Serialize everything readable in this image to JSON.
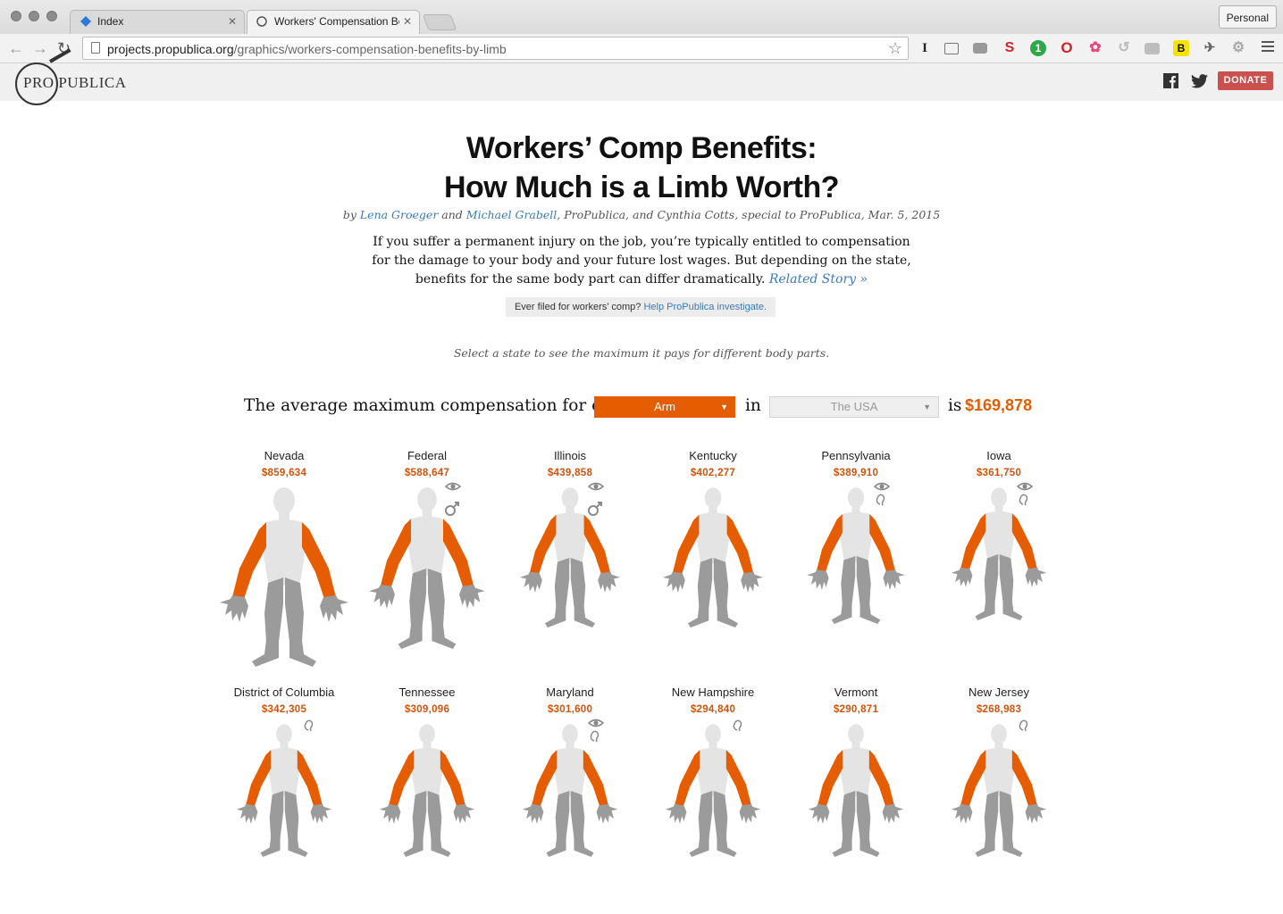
{
  "browser": {
    "tabs": [
      {
        "label": "Index",
        "active": false
      },
      {
        "label": "Workers' Compensation Be",
        "active": true
      }
    ],
    "profile": "Personal",
    "url_host": "projects.propublica.org",
    "url_path": "/graphics/workers-compensation-benefits-by-limb"
  },
  "site": {
    "logo_text": "PRO PUBLICA",
    "donate_label": "DONATE"
  },
  "article": {
    "title_line1": "Workers’ Comp Benefits:",
    "title_line2": "How Much is a Limb Worth?",
    "byline_by": "by",
    "author1": "Lena Groeger",
    "byline_and": "and",
    "author2": "Michael Grabell",
    "byline_rest": ", ProPublica, and Cynthia Cotts, special to ProPublica, Mar. 5, 2015",
    "intro_text": "If you suffer a permanent injury on the job, you’re typically entitled to compensation for the damage to your body and your future lost wages. But depending on the state, benefits for the same body part can differ dramatically.",
    "related_link": "Related Story »",
    "cta_text": "Ever filed for workers’ comp?",
    "cta_link": "Help ProPublica investigate.",
    "hint": "Select a state to see the maximum it pays for different body parts."
  },
  "selector": {
    "lead": "The average maximum compensation for one",
    "body_part": "Arm",
    "in_word": "in",
    "state": "The USA",
    "is_word": "is",
    "amount": "$169,878"
  },
  "colors": {
    "accent": "#e65c00",
    "body_gray": "#9b9b9b",
    "body_light": "#e4e4e4"
  },
  "states": [
    {
      "name": "Nevada",
      "amount": "$859,634",
      "scale": 1.0,
      "eye": false,
      "ear": false,
      "male": false
    },
    {
      "name": "Federal",
      "amount": "$588,647",
      "scale": 0.9,
      "eye": true,
      "ear": false,
      "male": true
    },
    {
      "name": "Illinois",
      "amount": "$439,858",
      "scale": 0.78,
      "eye": true,
      "ear": false,
      "male": true
    },
    {
      "name": "Kentucky",
      "amount": "$402,277",
      "scale": 0.78,
      "eye": false,
      "ear": false,
      "male": false
    },
    {
      "name": "Pennsylvania",
      "amount": "$389,910",
      "scale": 0.76,
      "eye": true,
      "ear": true,
      "male": false
    },
    {
      "name": "Iowa",
      "amount": "$361,750",
      "scale": 0.74,
      "eye": true,
      "ear": true,
      "male": false
    },
    {
      "name": "District of Columbia",
      "amount": "$342,305",
      "scale": 0.74,
      "eye": false,
      "ear": true,
      "male": false
    },
    {
      "name": "Tennessee",
      "amount": "$309,096",
      "scale": 0.74,
      "eye": false,
      "ear": false,
      "male": false
    },
    {
      "name": "Maryland",
      "amount": "$301,600",
      "scale": 0.74,
      "eye": true,
      "ear": true,
      "male": false
    },
    {
      "name": "New Hampshire",
      "amount": "$294,840",
      "scale": 0.74,
      "eye": false,
      "ear": true,
      "male": false
    },
    {
      "name": "Vermont",
      "amount": "$290,871",
      "scale": 0.74,
      "eye": false,
      "ear": false,
      "male": false
    },
    {
      "name": "New Jersey",
      "amount": "$268,983",
      "scale": 0.74,
      "eye": false,
      "ear": true,
      "male": false
    }
  ]
}
